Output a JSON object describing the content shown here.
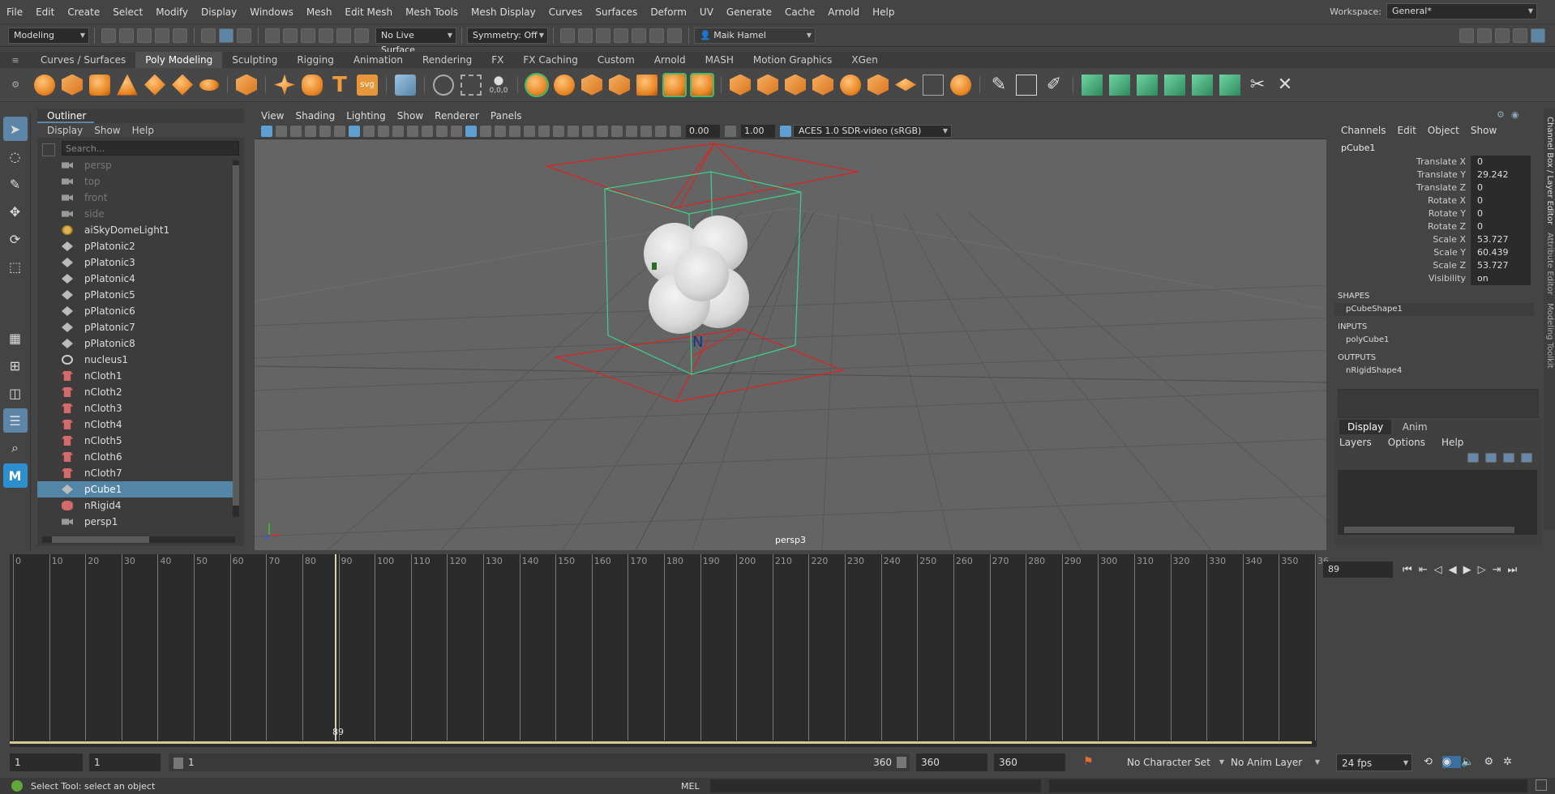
{
  "menubar": {
    "items": [
      "File",
      "Edit",
      "Create",
      "Select",
      "Modify",
      "Display",
      "Windows",
      "Mesh",
      "Edit Mesh",
      "Mesh Tools",
      "Mesh Display",
      "Curves",
      "Surfaces",
      "Deform",
      "UV",
      "Generate",
      "Cache",
      "Arnold",
      "Help"
    ],
    "workspace_label": "Workspace:",
    "workspace_value": "General*"
  },
  "statusline": {
    "mode": "Modeling",
    "live_surface": "No Live Surface",
    "symmetry": "Symmetry: Off",
    "user": "Maik Hamel"
  },
  "shelf": {
    "tabs": [
      "Curves / Surfaces",
      "Poly Modeling",
      "Sculpting",
      "Rigging",
      "Animation",
      "Rendering",
      "FX",
      "FX Caching",
      "Custom",
      "Arnold",
      "MASH",
      "Motion Graphics",
      "XGen"
    ],
    "active_tab": "Poly Modeling",
    "svg_label": "svg",
    "text_label": "T",
    "coord_label": "0,0,0"
  },
  "outliner": {
    "title": "Outliner",
    "menus": [
      "Display",
      "Show",
      "Help"
    ],
    "search_placeholder": "Search...",
    "items": [
      {
        "label": "persp",
        "icon": "camera-icon",
        "dim": true
      },
      {
        "label": "top",
        "icon": "camera-icon",
        "dim": true
      },
      {
        "label": "front",
        "icon": "camera-icon",
        "dim": true
      },
      {
        "label": "side",
        "icon": "camera-icon",
        "dim": true
      },
      {
        "label": "aiSkyDomeLight1",
        "icon": "skydome-icon"
      },
      {
        "label": "pPlatonic2",
        "icon": "mesh-icon"
      },
      {
        "label": "pPlatonic3",
        "icon": "mesh-icon"
      },
      {
        "label": "pPlatonic4",
        "icon": "mesh-icon"
      },
      {
        "label": "pPlatonic5",
        "icon": "mesh-icon"
      },
      {
        "label": "pPlatonic6",
        "icon": "mesh-icon"
      },
      {
        "label": "pPlatonic7",
        "icon": "mesh-icon"
      },
      {
        "label": "pPlatonic8",
        "icon": "mesh-icon"
      },
      {
        "label": "nucleus1",
        "icon": "nucleus-icon"
      },
      {
        "label": "nCloth1",
        "icon": "ncloth-icon"
      },
      {
        "label": "nCloth2",
        "icon": "ncloth-icon"
      },
      {
        "label": "nCloth3",
        "icon": "ncloth-icon"
      },
      {
        "label": "nCloth4",
        "icon": "ncloth-icon"
      },
      {
        "label": "nCloth5",
        "icon": "ncloth-icon"
      },
      {
        "label": "nCloth6",
        "icon": "ncloth-icon"
      },
      {
        "label": "nCloth7",
        "icon": "ncloth-icon"
      },
      {
        "label": "pCube1",
        "icon": "mesh-icon",
        "selected": true
      },
      {
        "label": "nRigid4",
        "icon": "nrigid-icon"
      },
      {
        "label": "persp1",
        "icon": "camera-icon"
      }
    ]
  },
  "viewport": {
    "menus": [
      "View",
      "Shading",
      "Lighting",
      "Show",
      "Renderer",
      "Panels"
    ],
    "near": "0.00",
    "far": "1.00",
    "colorspace": "ACES 1.0 SDR-video (sRGB)",
    "camera": "persp3"
  },
  "channelbox": {
    "menus": [
      "Channels",
      "Edit",
      "Object",
      "Show"
    ],
    "object": "pCube1",
    "attrs": [
      {
        "name": "Translate X",
        "value": "0"
      },
      {
        "name": "Translate Y",
        "value": "29.242"
      },
      {
        "name": "Translate Z",
        "value": "0"
      },
      {
        "name": "Rotate X",
        "value": "0"
      },
      {
        "name": "Rotate Y",
        "value": "0"
      },
      {
        "name": "Rotate Z",
        "value": "0"
      },
      {
        "name": "Scale X",
        "value": "53.727"
      },
      {
        "name": "Scale Y",
        "value": "60.439"
      },
      {
        "name": "Scale Z",
        "value": "53.727"
      },
      {
        "name": "Visibility",
        "value": "on"
      }
    ],
    "shapes_label": "SHAPES",
    "shape": "pCubeShape1",
    "inputs_label": "INPUTS",
    "input": "polyCube1",
    "outputs_label": "OUTPUTS",
    "output": "nRigidShape4",
    "side_tabs": [
      "Channel Box / Layer Editor",
      "Attribute Editor",
      "Modeling Toolkit"
    ]
  },
  "layer": {
    "tabs": [
      "Display",
      "Anim"
    ],
    "active": "Display",
    "menus": [
      "Layers",
      "Options",
      "Help"
    ]
  },
  "timeline": {
    "ticks": [
      "0",
      "10",
      "20",
      "30",
      "40",
      "50",
      "60",
      "70",
      "80",
      "90",
      "100",
      "110",
      "120",
      "130",
      "140",
      "150",
      "160",
      "170",
      "180",
      "190",
      "200",
      "210",
      "220",
      "230",
      "240",
      "250",
      "260",
      "270",
      "280",
      "290",
      "300",
      "310",
      "320",
      "330",
      "340",
      "350",
      "36"
    ],
    "current_frame": "89",
    "current_frame_field": "89"
  },
  "range": {
    "start": "1",
    "playback_start": "1",
    "slider_start": "1",
    "slider_end": "360",
    "playback_end": "360",
    "end": "360",
    "character_set": "No Character Set",
    "anim_layer": "No Anim Layer",
    "fps": "24 fps"
  },
  "cmdline": {
    "help": "Select Tool: select an object",
    "lang": "MEL"
  }
}
